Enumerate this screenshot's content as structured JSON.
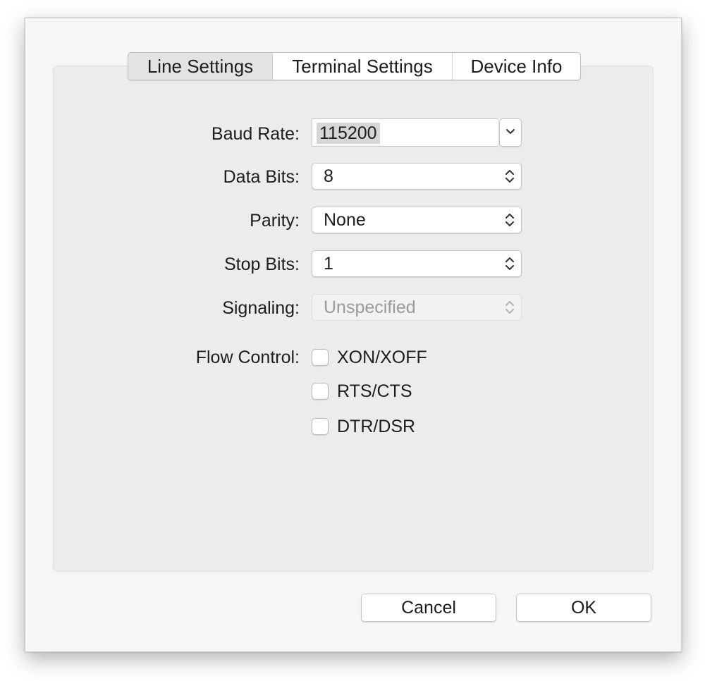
{
  "tabs": [
    {
      "label": "Line Settings",
      "active": true
    },
    {
      "label": "Terminal Settings",
      "active": false
    },
    {
      "label": "Device Info",
      "active": false
    }
  ],
  "form": {
    "baud_rate": {
      "label": "Baud Rate:",
      "value": "115200"
    },
    "data_bits": {
      "label": "Data Bits:",
      "value": "8"
    },
    "parity": {
      "label": "Parity:",
      "value": "None"
    },
    "stop_bits": {
      "label": "Stop Bits:",
      "value": "1"
    },
    "signaling": {
      "label": "Signaling:",
      "value": "Unspecified",
      "disabled": true
    },
    "flow_control": {
      "label": "Flow Control:",
      "options": [
        {
          "label": "XON/XOFF",
          "checked": false
        },
        {
          "label": "RTS/CTS",
          "checked": false
        },
        {
          "label": "DTR/DSR",
          "checked": false
        }
      ]
    }
  },
  "buttons": {
    "cancel": "Cancel",
    "ok": "OK"
  },
  "icons": {
    "combo_dropdown": "chevron-down-icon",
    "popup_stepper": "up-down-chevrons-icon"
  },
  "colors": {
    "dialog_bg": "#f6f6f6",
    "panel_bg": "#ececec",
    "selection_bg": "#d6d6d6",
    "disabled_text": "#9a9a9a"
  }
}
